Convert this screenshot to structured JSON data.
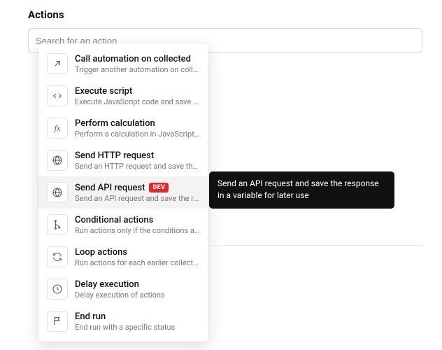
{
  "header": {
    "title": "Actions"
  },
  "search": {
    "placeholder": "Search for an action",
    "value": ""
  },
  "dropdown": {
    "items": [
      {
        "icon": "arrow-up-right",
        "label": "Call automation on collected",
        "desc": "Trigger another automation on collecte…",
        "badge": "",
        "hovered": false
      },
      {
        "icon": "code",
        "label": "Execute script",
        "desc": "Execute JavaScript code and save the …",
        "badge": "",
        "hovered": false
      },
      {
        "icon": "fx",
        "label": "Perform calculation",
        "desc": "Perform a calculation in JavaScript and…",
        "badge": "",
        "hovered": false
      },
      {
        "icon": "globe",
        "label": "Send HTTP request",
        "desc": "Send an HTTP request and save the re…",
        "badge": "",
        "hovered": false
      },
      {
        "icon": "globe",
        "label": "Send API request",
        "desc": "Send an API request and save the resp…",
        "badge": "DEV",
        "hovered": true
      },
      {
        "icon": "branch",
        "label": "Conditional actions",
        "desc": "Run actions only if the conditions are …",
        "badge": "",
        "hovered": false
      },
      {
        "icon": "loop",
        "label": "Loop actions",
        "desc": "Run actions for each earlier collected r…",
        "badge": "",
        "hovered": false
      },
      {
        "icon": "clock",
        "label": "Delay execution",
        "desc": "Delay execution of actions",
        "badge": "",
        "hovered": false
      },
      {
        "icon": "flag",
        "label": "End run",
        "desc": "End run with a specific status",
        "badge": "",
        "hovered": false
      }
    ]
  },
  "tooltip": {
    "text": "Send an API request and save the response in a variable for later use"
  }
}
